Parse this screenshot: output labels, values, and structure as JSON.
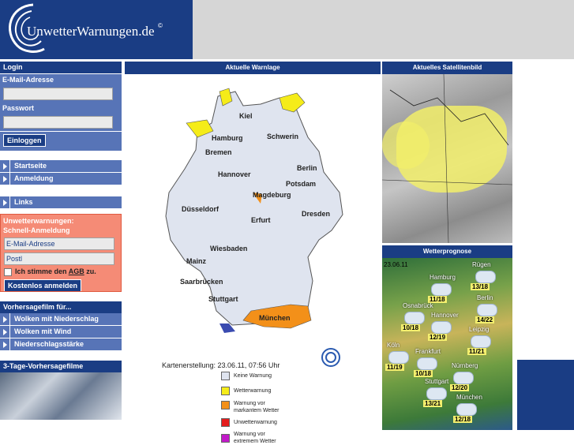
{
  "header": {
    "logo_text": "UnwetterWarnungen.de",
    "logo_reg": "©"
  },
  "login": {
    "title": "Login",
    "email_label": "E-Mail-Adresse",
    "password_label": "Passwort",
    "button": "Einloggen"
  },
  "nav": {
    "items": [
      {
        "label": "Startseite"
      },
      {
        "label": "Anmeldung"
      },
      {
        "label": "Links"
      }
    ]
  },
  "quick": {
    "title_line1": "Unwetterwarnungen:",
    "title_line2": "Schnell-Anmeldung",
    "email_placeholder": "E-Mail-Adresse",
    "zip_placeholder": "Postl",
    "agree_prefix": "Ich stimme den",
    "agree_link": "AGB",
    "agree_suffix": "zu.",
    "button": "Kostenlos anmelden"
  },
  "film": {
    "title": "Vorhersagefilm für...",
    "items": [
      {
        "label": "Wolken mit Niederschlag"
      },
      {
        "label": "Wolken mit Wind"
      },
      {
        "label": "Niederschlagsstärke"
      }
    ],
    "forecast_title": "3-Tage-Vorhersagefilme"
  },
  "map": {
    "title": "Aktuelle Warnlage",
    "cities": [
      "Kiel",
      "Hamburg",
      "Schwerin",
      "Bremen",
      "Berlin",
      "Hannover",
      "Potsdam",
      "Magdeburg",
      "Düsseldorf",
      "Dresden",
      "Erfurt",
      "Wiesbaden",
      "Mainz",
      "Saarbrücken",
      "Stuttgart",
      "München"
    ],
    "timestamp": "Kartenerstellung: 23.06.11, 07:56 Uhr",
    "legend": [
      {
        "label": "Keine Warnung",
        "color": "#dfe4ef"
      },
      {
        "label": "Wetterwarnung",
        "color": "#f5ec19"
      },
      {
        "label": "Warnung vor markantem Wetter",
        "color": "#f39019"
      },
      {
        "label": "Unwetterwarnung",
        "color": "#e41c1c"
      },
      {
        "label": "Warnung vor extremem Wetter",
        "color": "#c21ac9"
      }
    ]
  },
  "satellite": {
    "title": "Aktuelles Satellitenbild"
  },
  "prognose": {
    "title": "Wetterprognose",
    "date": "23.06.11",
    "cities": [
      {
        "name": "Rügen",
        "temps": "13/18"
      },
      {
        "name": "Hamburg",
        "temps": "11/18"
      },
      {
        "name": "Berlin",
        "temps": "14/22"
      },
      {
        "name": "Osnabrück",
        "temps": "10/18"
      },
      {
        "name": "Hannover",
        "temps": "12/19"
      },
      {
        "name": "Leipzig",
        "temps": "11/21"
      },
      {
        "name": "Köln",
        "temps": "11/19"
      },
      {
        "name": "Frankfurt",
        "temps": "10/18"
      },
      {
        "name": "Nürnberg",
        "temps": "12/20"
      },
      {
        "name": "Stuttgart",
        "temps": "13/21"
      },
      {
        "name": "München",
        "temps": "12/18"
      }
    ]
  }
}
